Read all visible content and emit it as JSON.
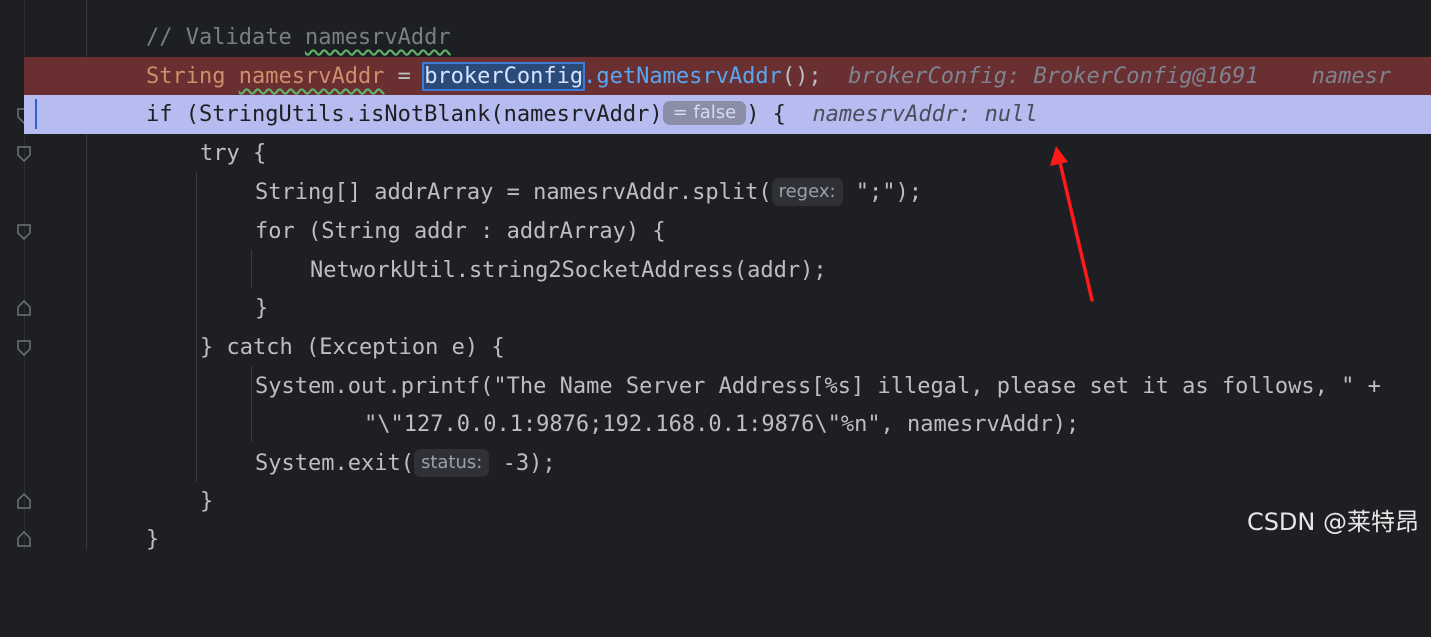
{
  "editor": {
    "lines": [
      {
        "comment": "// Validate ",
        "comment_word": "namesrvAddr"
      },
      {
        "kw": "String",
        "var": "namesrvAddr",
        "eq": " = ",
        "sel": "brokerConfig",
        "call": ".getNamesrvAddr",
        "rest": "();",
        "inline_debug": "brokerConfig: BrokerConfig@1691    namesr"
      },
      {
        "pre": "if (StringUtils.isNotBlank(namesrvAddr)",
        "hint": "= false",
        "post": ") {",
        "inline_debug": "namesrvAddr: null"
      },
      {
        "text": "try {"
      },
      {
        "pre": "String[] addrArray = namesrvAddr.split(",
        "param_hint": "regex:",
        "post": "\";\");"
      },
      {
        "text": "for (String addr : addrArray) {"
      },
      {
        "text": "NetworkUtil.string2SocketAddress(addr);"
      },
      {
        "text": "}"
      },
      {
        "text": "} catch (Exception e) {"
      },
      {
        "text": "System.out.printf(\"The Name Server Address[%s] illegal, please set it as follows, \" +"
      },
      {
        "text": "\"\\\"127.0.0.1:9876;192.168.0.1:9876\\\"%n\", namesrvAddr);"
      },
      {
        "pre": "System.exit(",
        "param_hint": "status:",
        "post": "-3);"
      },
      {
        "text": "}"
      },
      {
        "text": "}"
      }
    ]
  },
  "annotation": {
    "arrow_color": "#ff1a1a"
  },
  "watermark": "CSDN @莱特昂"
}
